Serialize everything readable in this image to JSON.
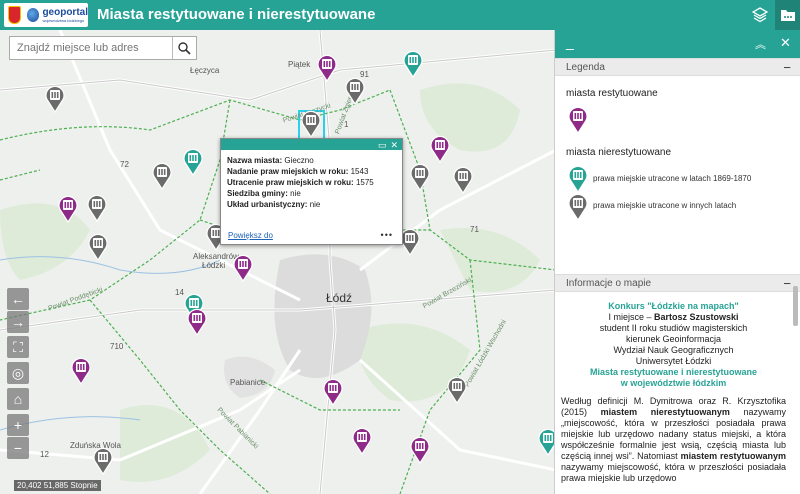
{
  "header": {
    "logo_text": "geoportal",
    "logo_subtext": "województwa łódzkiego",
    "title": "Miasta restytuowane i nierestytuowane",
    "layers_icon": "layers-icon",
    "folder_icon": "folder-icon"
  },
  "search": {
    "placeholder": "Znajdź miejsce lub adres"
  },
  "map_labels": {
    "leczyca": "Łęczyca",
    "piatek": "Piątek",
    "powiat_leczycki": "Powiat Łęczycki",
    "powiat_zgierski": "Powiat Zgierski",
    "aleksandrow_1": "Aleksandrów",
    "aleksandrow_2": "Łódzki",
    "lodz": "Łódź",
    "powiat_poddebicki": "Powiat Poddębicki",
    "powiat_brzezinski": "Powiat Brzeziński",
    "powiat_lodzki_wschodni": "Powiat Łódzki Wschodni",
    "pabianice": "Pabianice",
    "zdunska_wola_1": "Zduńska Wola",
    "powiat_pabianicki": "Powiat Pabianicki",
    "road_91": "91",
    "road_1": "1",
    "road_72": "72",
    "road_14": "14",
    "road_71": "71",
    "road_12": "12",
    "road_710": "710"
  },
  "scale": "20,402 51,885 Stopnie",
  "popup": {
    "fields": [
      {
        "label": "Nazwa miasta:",
        "value": "Gieczno"
      },
      {
        "label": "Nadanie praw miejskich w roku:",
        "value": "1543"
      },
      {
        "label": "Utracenie praw miejskich w roku:",
        "value": "1575"
      },
      {
        "label": "Siedziba gminy:",
        "value": "nie"
      },
      {
        "label": "Układ urbanistyczny:",
        "value": "nie"
      }
    ],
    "zoom_label": "Powiększ do",
    "more_label": "•••"
  },
  "panel": {
    "legend_title": "Legenda",
    "restytuowane_header": "miasta restytuowane",
    "nierestytuowane_header": "miasta nierestytuowane",
    "item_teal": "prawa miejskie utracone w latach 1869-1870",
    "item_gray": "prawa miejskie utracone w innych latach",
    "info_title": "Informacje o mapie",
    "contest": "Konkurs \"Łódzkie na mapach\"",
    "place_line_prefix": "I miejsce – ",
    "author": "Bartosz Szustowski",
    "study_1": "student II roku studiów magisterskich",
    "study_2": "kierunek Geoinformacja",
    "faculty": "Wydział Nauk Geograficznych",
    "university": "Uniwersytet Łódzki",
    "map_title_1": "Miasta restytuowane i nierestytuowane",
    "map_title_2": "w województwie łódzkim",
    "desc_1": "Według definicji M. Dymitrowa oraz R. Krzysztofika (2015) ",
    "desc_bold_1": "miastem nierestytuowanym",
    "desc_2": " nazywamy „miejscowość, która w przeszłości posiadała prawa miejskie lub urzędowo nadany status miejski, a która współcześnie formalnie jest wsią, częścią miasta lub częścią innej wsi”. Natomiast ",
    "desc_bold_2": "miastem restytuowanym",
    "desc_3": " nazywamy miejscowość, która w przeszłości posiadała prawa miejskie lub urzędowo"
  },
  "colors": {
    "accent": "#27a396",
    "pin_purple": "#8e2a87",
    "pin_teal": "#27a396",
    "pin_gray": "#6b6b6b"
  }
}
